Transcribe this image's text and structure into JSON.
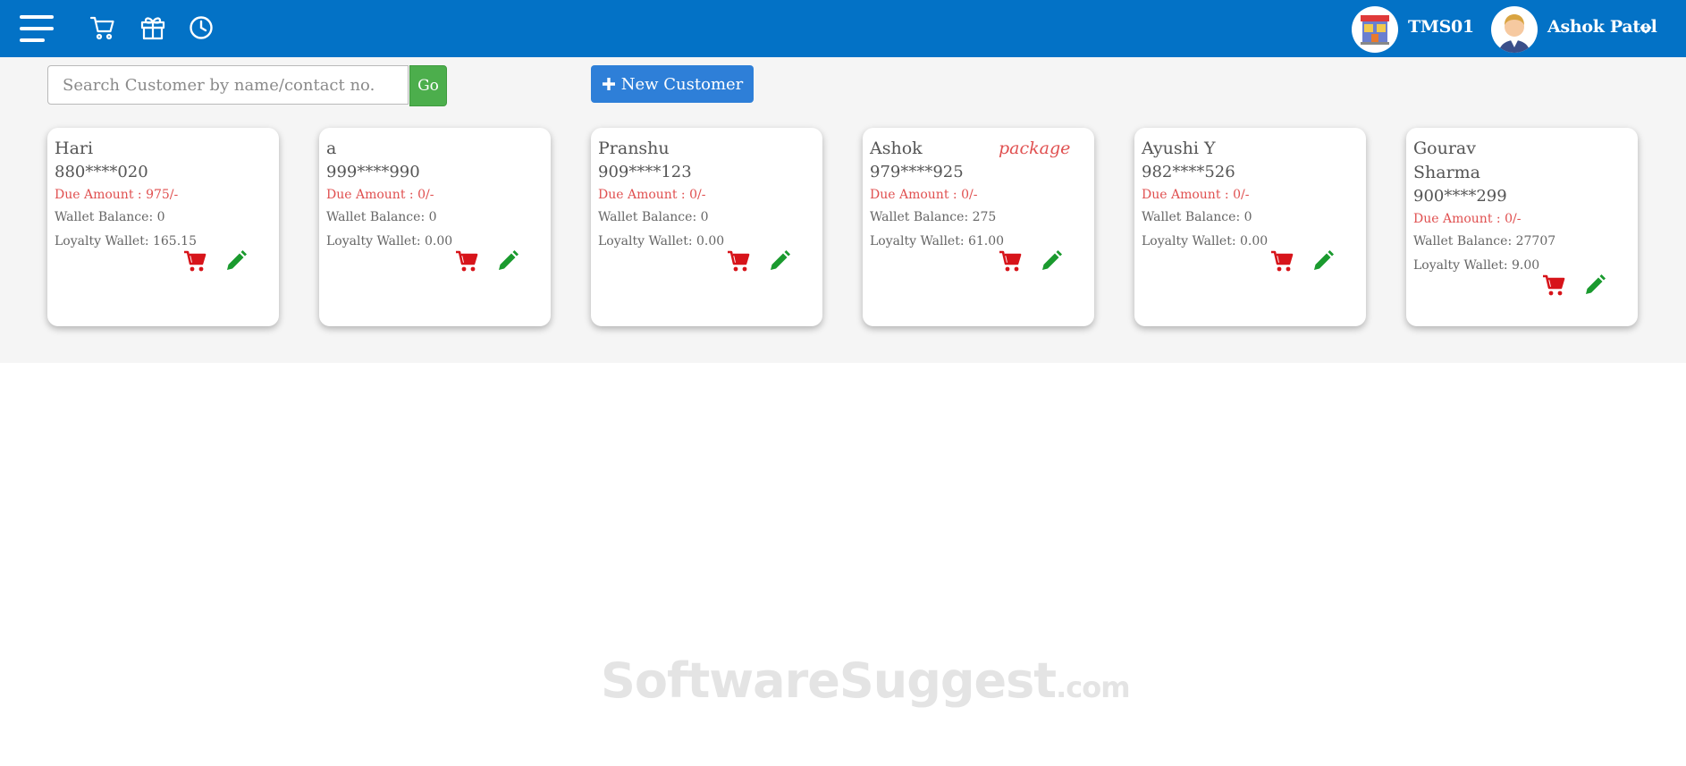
{
  "header": {
    "store_name": "TMS01",
    "user_name": "Ashok Patel",
    "icons": [
      "menu-icon",
      "cart-icon",
      "gift-icon",
      "clock-icon",
      "chevron-down-icon"
    ],
    "bar_color": "#0372c6"
  },
  "search": {
    "placeholder": "Search Customer by name/contact no.",
    "value": "",
    "go_label": "Go"
  },
  "new_customer_label": "New Customer",
  "customers": [
    {
      "name": "Hari",
      "tag": "",
      "phone": "880****020",
      "due": "Due Amount : 975/-",
      "wallet": "Wallet Balance: 0",
      "loyalty": "Loyalty Wallet: 165.15"
    },
    {
      "name": "a",
      "tag": "",
      "phone": "999****990",
      "due": "Due Amount : 0/-",
      "wallet": "Wallet Balance: 0",
      "loyalty": "Loyalty Wallet: 0.00"
    },
    {
      "name": "Pranshu",
      "tag": "",
      "phone": "909****123",
      "due": "Due Amount : 0/-",
      "wallet": "Wallet Balance: 0",
      "loyalty": "Loyalty Wallet: 0.00"
    },
    {
      "name": "Ashok",
      "tag": "package",
      "phone": "979****925",
      "due": "Due Amount : 0/-",
      "wallet": "Wallet Balance: 275",
      "loyalty": "Loyalty Wallet: 61.00"
    },
    {
      "name": "Ayushi Y",
      "tag": "",
      "phone": "982****526",
      "due": "Due Amount : 0/-",
      "wallet": "Wallet Balance: 0",
      "loyalty": "Loyalty Wallet: 0.00"
    },
    {
      "name": "Gourav Sharma",
      "tag": "",
      "phone": "900****299",
      "due": "Due Amount : 0/-",
      "wallet": "Wallet Balance: 27707",
      "loyalty": "Loyalty Wallet: 9.00"
    }
  ],
  "colors": {
    "due": "#e05050",
    "cart_action": "#d7141a",
    "edit_action": "#1a9a2e",
    "go_button": "#4cae4c",
    "new_customer_button": "#2e7fd8"
  },
  "watermark": {
    "main": "SoftwareSuggest",
    "suffix": ".com"
  }
}
